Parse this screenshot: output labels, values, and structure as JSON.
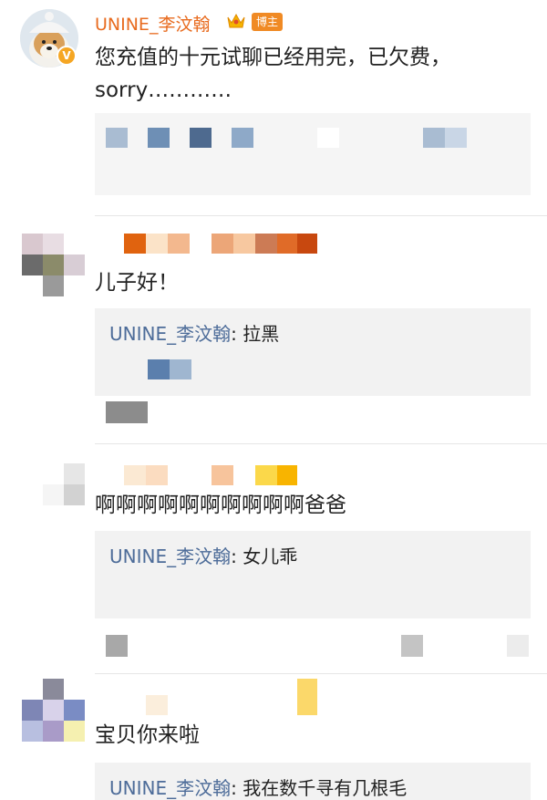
{
  "colors": {
    "username": "#e86b1f",
    "reply_username": "#4d6c99",
    "reply_bg": "#f2f2f2",
    "badge": "#f08a24"
  },
  "comments": [
    {
      "username": "UNINE_李汶翰",
      "badge_label": "博主",
      "text_line1": "您充值的十元试聊已经用完，已欠费，",
      "text_line2": "sorry…………",
      "avatar_icon": "dog-avatar-icon",
      "verified_icon": "verified-v-icon",
      "crown_icon": "crown-icon"
    },
    {
      "text": "儿子好！",
      "reply": {
        "username": "UNINE_李汶翰",
        "sep": ": ",
        "text": "拉黑"
      }
    },
    {
      "text": "啊啊啊啊啊啊啊啊啊啊爸爸",
      "reply": {
        "username": "UNINE_李汶翰",
        "sep": ": ",
        "text": "女儿乖"
      }
    },
    {
      "text": "宝贝你来啦",
      "reply": {
        "username": "UNINE_李汶翰",
        "sep": ": ",
        "text": "我在数千寻有几根毛"
      }
    }
  ]
}
